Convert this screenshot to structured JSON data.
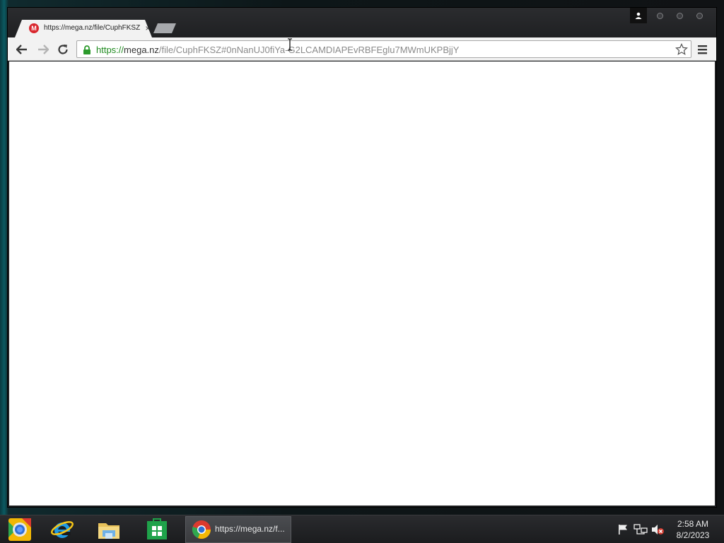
{
  "browser": {
    "tab": {
      "title": "https://mega.nz/file/CuphFKSZ",
      "favicon_letter": "M",
      "close": "×"
    },
    "address_bar": {
      "scheme": "https://",
      "host": "mega.nz",
      "path": "/file/CuphFKSZ#0nNanUJ0fiYa-G2LCAMDIAPEvRBFEglu7MWmUKPBjjY"
    },
    "icons": {
      "back": "back-arrow-icon",
      "forward": "forward-arrow-icon",
      "reload": "reload-icon",
      "lock": "lock-icon",
      "star": "star-icon",
      "menu": "hamburger-menu-icon",
      "profile": "person-icon"
    }
  },
  "taskbar": {
    "pinned": [
      "chrome-canary-icon",
      "internet-explorer-icon",
      "file-explorer-icon",
      "windows-store-icon"
    ],
    "active_window_label": "https://mega.nz/f...",
    "tray_icons": [
      "action-center-flag-icon",
      "network-icon",
      "volume-muted-icon"
    ],
    "time": "2:58 AM",
    "date": "8/2/2023"
  },
  "colors": {
    "secure_scheme": "#1e8a1e",
    "mega_red": "#d9272e",
    "taskbar": "#1b1c1e"
  }
}
